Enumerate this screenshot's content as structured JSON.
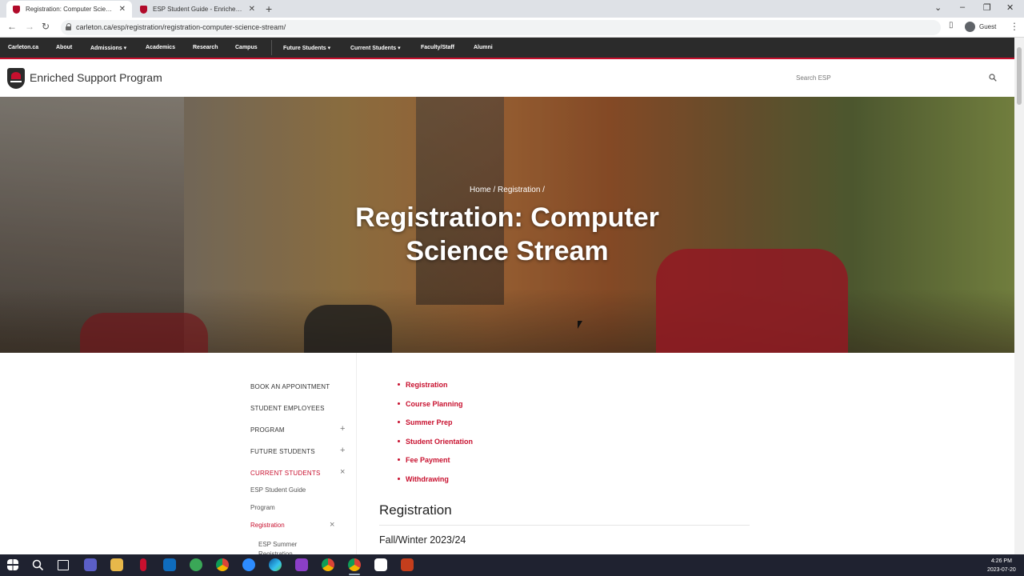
{
  "browser": {
    "tabs": [
      {
        "title": "Registration: Computer Science S",
        "active": true
      },
      {
        "title": "ESP Student Guide - Enriched Su",
        "active": false
      }
    ],
    "url": "carleton.ca/esp/registration/registration-computer-science-stream/",
    "profile_label": "Guest"
  },
  "site_nav": {
    "items": [
      "Carleton.ca",
      "About",
      "Admissions ▾",
      "Academics",
      "Research",
      "Campus",
      "Future Students ▾",
      "Current Students ▾",
      "Faculty/Staff",
      "Alumni"
    ]
  },
  "header": {
    "site_name": "Enriched Support Program",
    "search_placeholder": "Search ESP"
  },
  "hero": {
    "breadcrumb": "Home / Registration /",
    "title": "Registration: Computer Science Stream"
  },
  "sidebar": {
    "items": [
      {
        "label": "BOOK AN APPOINTMENT"
      },
      {
        "label": "STUDENT EMPLOYEES"
      },
      {
        "label": "PROGRAM",
        "control": "+"
      },
      {
        "label": "FUTURE STUDENTS",
        "control": "+"
      },
      {
        "label": "CURRENT STUDENTS",
        "control": "×"
      }
    ],
    "subitems": [
      {
        "label": "ESP Student Guide"
      },
      {
        "label": "Program"
      },
      {
        "label": "Registration",
        "control": "×"
      },
      {
        "label": "ESP Summer Registration"
      }
    ]
  },
  "content": {
    "links": [
      "Registration",
      "Course Planning",
      "Summer Prep",
      "Student Orientation",
      "Fee Payment",
      "Withdrawing"
    ],
    "heading": "Registration",
    "subheading": "Fall/Winter 2023/24"
  },
  "taskbar": {
    "time": "4:26 PM",
    "date": "2023-07-20"
  },
  "colors": {
    "accent": "#c8102e",
    "nav_bg": "#2b2b2b",
    "taskbar_bg": "#1f2230"
  }
}
